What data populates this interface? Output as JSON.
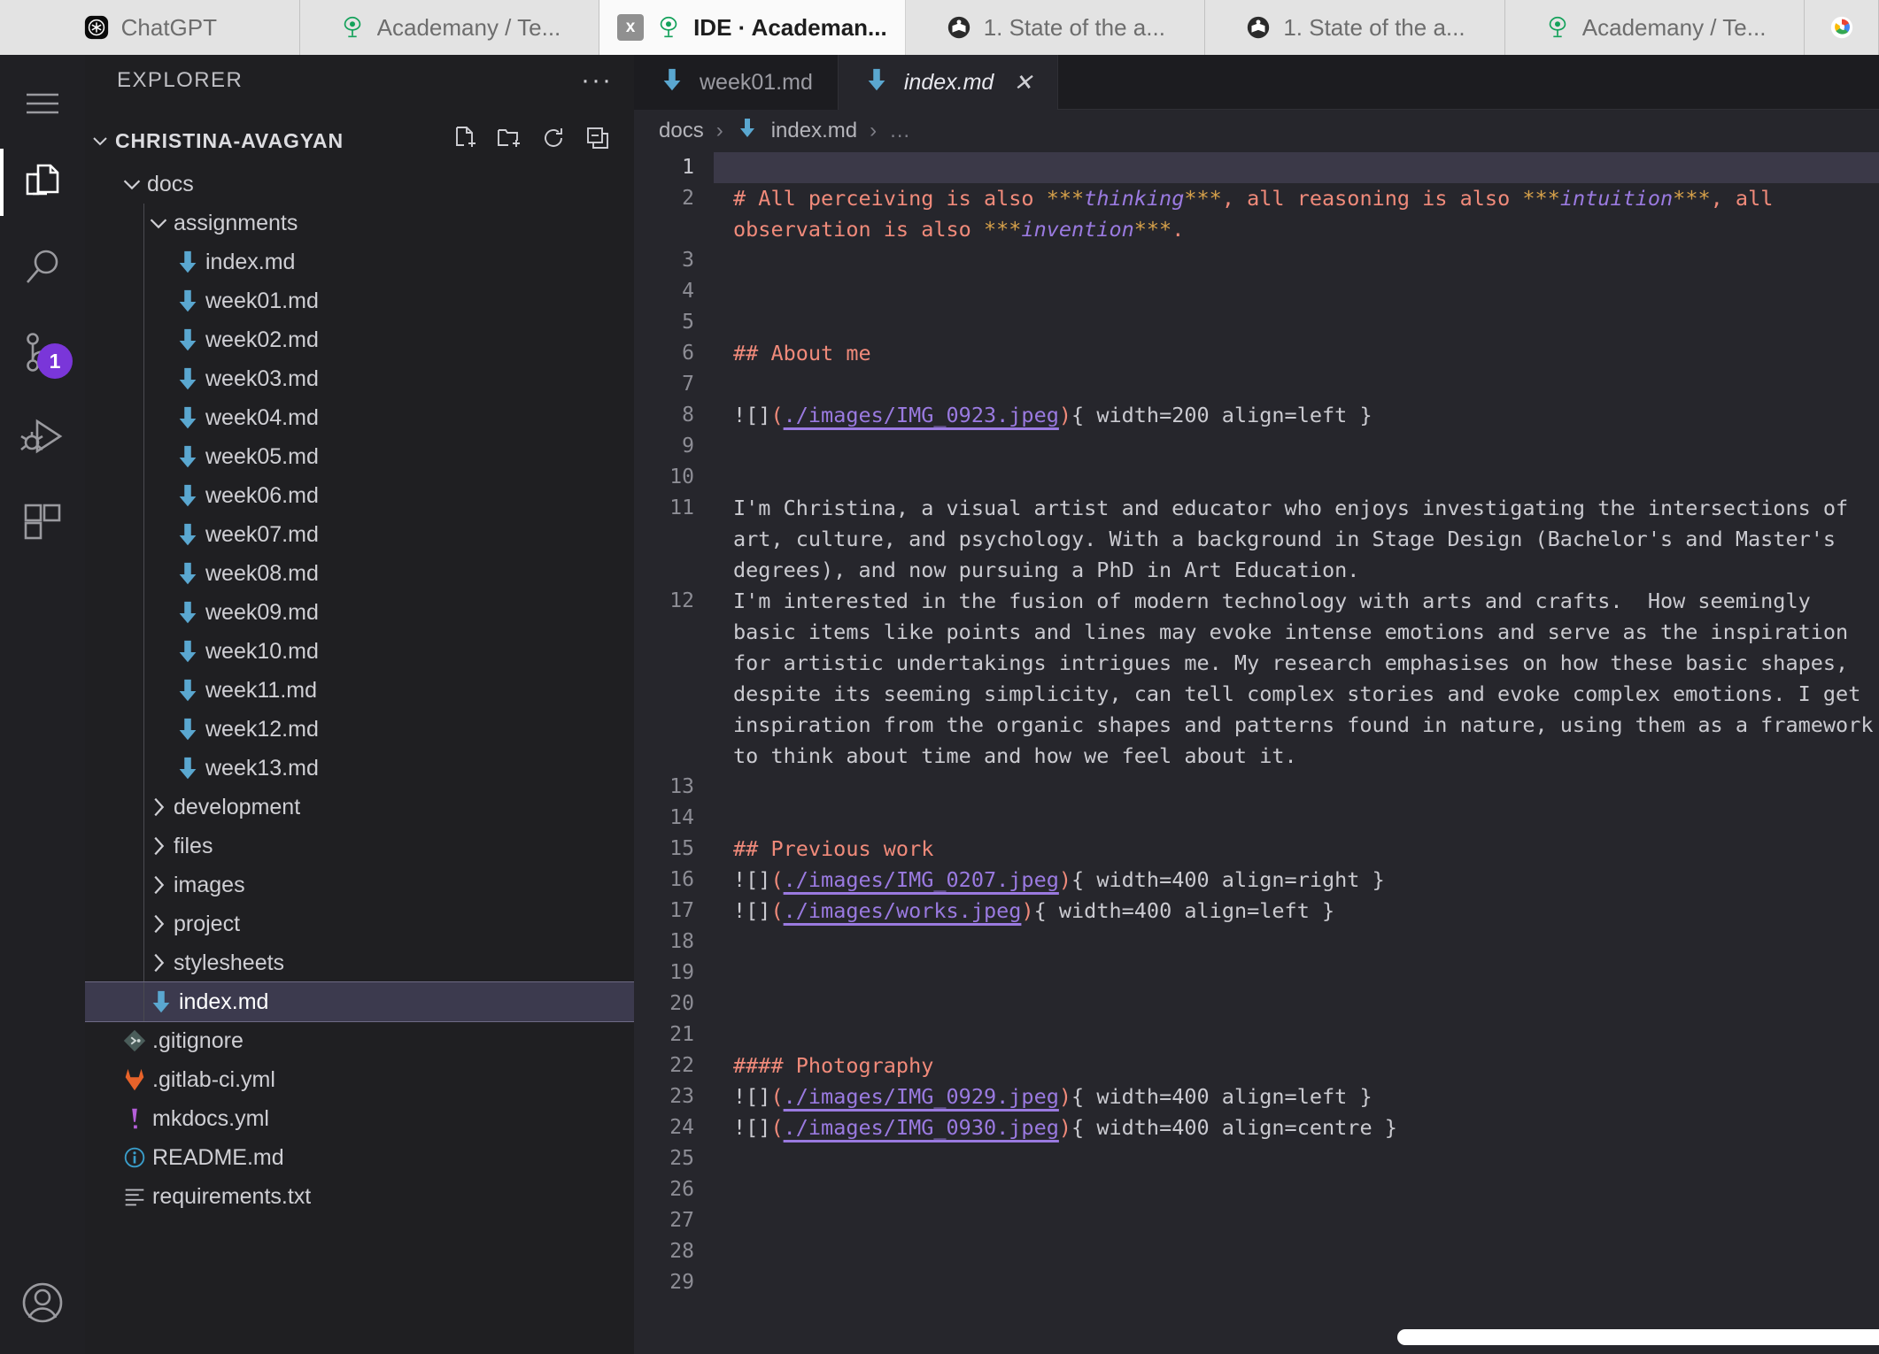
{
  "browser": {
    "tabs": [
      {
        "label": "ChatGPT",
        "icon": "chatgpt-icon",
        "active": false,
        "closable": false
      },
      {
        "label": "Academany / Te...",
        "icon": "academany-icon",
        "active": false,
        "closable": false
      },
      {
        "label": "IDE · Academan...",
        "icon": "academany-icon",
        "active": true,
        "closable": true,
        "close_label": "x"
      },
      {
        "label": "1. State of the a...",
        "icon": "book-circle-icon",
        "active": false,
        "closable": false
      },
      {
        "label": "1. State of the a...",
        "icon": "book-circle-icon",
        "active": false,
        "closable": false
      },
      {
        "label": "Academany / Te...",
        "icon": "academany-icon",
        "active": false,
        "closable": false
      },
      {
        "label": "",
        "icon": "google-icon",
        "active": false,
        "closable": false
      }
    ]
  },
  "activity_bar": {
    "items": [
      {
        "name": "menu-icon",
        "label": "Menu",
        "active": false
      },
      {
        "name": "explorer-icon",
        "label": "Explorer",
        "active": true
      },
      {
        "name": "search-icon",
        "label": "Search",
        "active": false
      },
      {
        "name": "source-control-icon",
        "label": "Source Control",
        "active": false,
        "badge": "1"
      },
      {
        "name": "run-debug-icon",
        "label": "Run and Debug",
        "active": false
      },
      {
        "name": "extensions-icon",
        "label": "Extensions",
        "active": false
      }
    ],
    "account": {
      "name": "account-icon",
      "label": "Accounts"
    },
    "badge_color": "#7a36d9"
  },
  "sidebar": {
    "title": "EXPLORER",
    "overflow_label": "···",
    "root": {
      "label": "CHRISTINA-AVAGYAN",
      "expanded": true,
      "actions": [
        {
          "name": "new-file-icon",
          "label": "New File"
        },
        {
          "name": "new-folder-icon",
          "label": "New Folder"
        },
        {
          "name": "refresh-icon",
          "label": "Refresh Explorer"
        },
        {
          "name": "collapse-all-icon",
          "label": "Collapse Folders"
        }
      ]
    },
    "tree": [
      {
        "label": "docs",
        "type": "folder",
        "expanded": true,
        "depth": 1,
        "icon": "chevron-down-icon"
      },
      {
        "label": "assignments",
        "type": "folder",
        "expanded": true,
        "depth": 2,
        "icon": "chevron-down-icon"
      },
      {
        "label": "index.md",
        "type": "file",
        "depth": 3,
        "icon": "markdown-icon"
      },
      {
        "label": "week01.md",
        "type": "file",
        "depth": 3,
        "icon": "markdown-icon"
      },
      {
        "label": "week02.md",
        "type": "file",
        "depth": 3,
        "icon": "markdown-icon"
      },
      {
        "label": "week03.md",
        "type": "file",
        "depth": 3,
        "icon": "markdown-icon"
      },
      {
        "label": "week04.md",
        "type": "file",
        "depth": 3,
        "icon": "markdown-icon"
      },
      {
        "label": "week05.md",
        "type": "file",
        "depth": 3,
        "icon": "markdown-icon"
      },
      {
        "label": "week06.md",
        "type": "file",
        "depth": 3,
        "icon": "markdown-icon"
      },
      {
        "label": "week07.md",
        "type": "file",
        "depth": 3,
        "icon": "markdown-icon"
      },
      {
        "label": "week08.md",
        "type": "file",
        "depth": 3,
        "icon": "markdown-icon"
      },
      {
        "label": "week09.md",
        "type": "file",
        "depth": 3,
        "icon": "markdown-icon"
      },
      {
        "label": "week10.md",
        "type": "file",
        "depth": 3,
        "icon": "markdown-icon"
      },
      {
        "label": "week11.md",
        "type": "file",
        "depth": 3,
        "icon": "markdown-icon"
      },
      {
        "label": "week12.md",
        "type": "file",
        "depth": 3,
        "icon": "markdown-icon"
      },
      {
        "label": "week13.md",
        "type": "file",
        "depth": 3,
        "icon": "markdown-icon"
      },
      {
        "label": "development",
        "type": "folder",
        "expanded": false,
        "depth": 2,
        "icon": "chevron-right-icon"
      },
      {
        "label": "files",
        "type": "folder",
        "expanded": false,
        "depth": 2,
        "icon": "chevron-right-icon"
      },
      {
        "label": "images",
        "type": "folder",
        "expanded": false,
        "depth": 2,
        "icon": "chevron-right-icon"
      },
      {
        "label": "project",
        "type": "folder",
        "expanded": false,
        "depth": 2,
        "icon": "chevron-right-icon"
      },
      {
        "label": "stylesheets",
        "type": "folder",
        "expanded": false,
        "depth": 2,
        "icon": "chevron-right-icon"
      },
      {
        "label": "index.md",
        "type": "file",
        "depth": 2,
        "icon": "markdown-icon",
        "selected": true
      },
      {
        "label": ".gitignore",
        "type": "file",
        "depth": 1,
        "icon": "git-icon"
      },
      {
        "label": ".gitlab-ci.yml",
        "type": "file",
        "depth": 1,
        "icon": "gitlab-icon"
      },
      {
        "label": "mkdocs.yml",
        "type": "file",
        "depth": 1,
        "icon": "mkdocs-icon"
      },
      {
        "label": "README.md",
        "type": "file",
        "depth": 1,
        "icon": "info-icon"
      },
      {
        "label": "requirements.txt",
        "type": "file",
        "depth": 1,
        "icon": "text-lines-icon"
      }
    ]
  },
  "editor": {
    "tabs": [
      {
        "label": "week01.md",
        "icon": "markdown-icon",
        "active": false,
        "closable": false
      },
      {
        "label": "index.md",
        "icon": "markdown-icon",
        "active": true,
        "closable": true,
        "close_label": "✕"
      }
    ],
    "breadcrumb": [
      {
        "label": "docs",
        "icon": null
      },
      {
        "label": "index.md",
        "icon": "markdown-icon"
      },
      {
        "label": "…",
        "icon": null
      }
    ],
    "breadcrumb_separator": "›",
    "cursor_line": 1,
    "lines": [
      {
        "n": 1,
        "segments": []
      },
      {
        "n": 2,
        "segments": [
          {
            "t": "# All perceiving is also ",
            "c": "md-h"
          },
          {
            "t": "***",
            "c": "md-bold-mark"
          },
          {
            "t": "thinking",
            "c": "md-em"
          },
          {
            "t": "***",
            "c": "md-bold-mark"
          },
          {
            "t": ", all reasoning is also ",
            "c": "md-h"
          },
          {
            "t": "***",
            "c": "md-bold-mark"
          },
          {
            "t": "intuition",
            "c": "md-em"
          },
          {
            "t": "***",
            "c": "md-bold-mark"
          },
          {
            "t": ", all observation is also ",
            "c": "md-h"
          },
          {
            "t": "***",
            "c": "md-bold-mark"
          },
          {
            "t": "invention",
            "c": "md-em"
          },
          {
            "t": "***",
            "c": "md-bold-mark"
          },
          {
            "t": ".",
            "c": "md-h"
          }
        ]
      },
      {
        "n": 3,
        "segments": []
      },
      {
        "n": 4,
        "segments": []
      },
      {
        "n": 5,
        "segments": []
      },
      {
        "n": 6,
        "segments": [
          {
            "t": "## About me",
            "c": "md-h"
          }
        ]
      },
      {
        "n": 7,
        "segments": []
      },
      {
        "n": 8,
        "segments": [
          {
            "t": "![]",
            "c": "md-bang"
          },
          {
            "t": "(",
            "c": "md-paren"
          },
          {
            "t": "./images/IMG_0923.jpeg",
            "c": "md-link"
          },
          {
            "t": ")",
            "c": "md-paren"
          },
          {
            "t": "{ width=200 align=left }",
            "c": "md-attr"
          }
        ]
      },
      {
        "n": 9,
        "segments": []
      },
      {
        "n": 10,
        "segments": []
      },
      {
        "n": 11,
        "segments": [
          {
            "t": "I'm Christina, a visual artist and educator who enjoys investigating the intersections of art, culture, and psychology. With a background in Stage Design (Bachelor's and Master's degrees), and now pursuing a PhD in Art Education.",
            "c": "md-attr"
          }
        ]
      },
      {
        "n": 12,
        "segments": [
          {
            "t": "I'm interested in the fusion of modern technology with arts and crafts.  How seemingly basic items like points and lines may evoke intense emotions and serve as the inspiration for artistic undertakings intrigues me. My research emphasises on how these basic shapes, despite its seeming simplicity, can tell complex stories and evoke complex emotions. I get inspiration from the organic shapes and patterns found in nature, using them as a framework to think about time and how we feel about it.",
            "c": "md-attr"
          }
        ]
      },
      {
        "n": 13,
        "segments": []
      },
      {
        "n": 14,
        "segments": []
      },
      {
        "n": 15,
        "segments": [
          {
            "t": "## Previous work",
            "c": "md-h"
          }
        ]
      },
      {
        "n": 16,
        "segments": [
          {
            "t": "![]",
            "c": "md-bang"
          },
          {
            "t": "(",
            "c": "md-paren"
          },
          {
            "t": "./images/IMG_0207.jpeg",
            "c": "md-link"
          },
          {
            "t": ")",
            "c": "md-paren"
          },
          {
            "t": "{ width=400 align=right }",
            "c": "md-attr"
          }
        ]
      },
      {
        "n": 17,
        "segments": [
          {
            "t": "![]",
            "c": "md-bang"
          },
          {
            "t": "(",
            "c": "md-paren"
          },
          {
            "t": "./images/works.jpeg",
            "c": "md-link"
          },
          {
            "t": ")",
            "c": "md-paren"
          },
          {
            "t": "{ width=400 align=left }",
            "c": "md-attr"
          }
        ]
      },
      {
        "n": 18,
        "segments": []
      },
      {
        "n": 19,
        "segments": []
      },
      {
        "n": 20,
        "segments": []
      },
      {
        "n": 21,
        "segments": []
      },
      {
        "n": 22,
        "segments": [
          {
            "t": "#### Photography",
            "c": "md-h"
          }
        ]
      },
      {
        "n": 23,
        "segments": [
          {
            "t": "![]",
            "c": "md-bang"
          },
          {
            "t": "(",
            "c": "md-paren"
          },
          {
            "t": "./images/IMG_0929.jpeg",
            "c": "md-link"
          },
          {
            "t": ")",
            "c": "md-paren"
          },
          {
            "t": "{ width=400 align=left }",
            "c": "md-attr"
          }
        ]
      },
      {
        "n": 24,
        "segments": [
          {
            "t": "![]",
            "c": "md-bang"
          },
          {
            "t": "(",
            "c": "md-paren"
          },
          {
            "t": "./images/IMG_0930.jpeg",
            "c": "md-link"
          },
          {
            "t": ")",
            "c": "md-paren"
          },
          {
            "t": "{ width=400 align=centre }",
            "c": "md-attr"
          }
        ]
      },
      {
        "n": 25,
        "segments": []
      },
      {
        "n": 26,
        "segments": []
      },
      {
        "n": 27,
        "segments": []
      },
      {
        "n": 28,
        "segments": []
      },
      {
        "n": 29,
        "segments": []
      }
    ]
  },
  "colors": {
    "accent": "#7a36d9",
    "markdown_icon": "#5aa7d0",
    "heading": "#f08a7a",
    "emphasis": "#9a7ae0",
    "bold_marker": "#d6a14a",
    "editor_bg": "#26262c",
    "sidebar_bg": "#1f1f22",
    "selection": "#3c3a4e"
  }
}
